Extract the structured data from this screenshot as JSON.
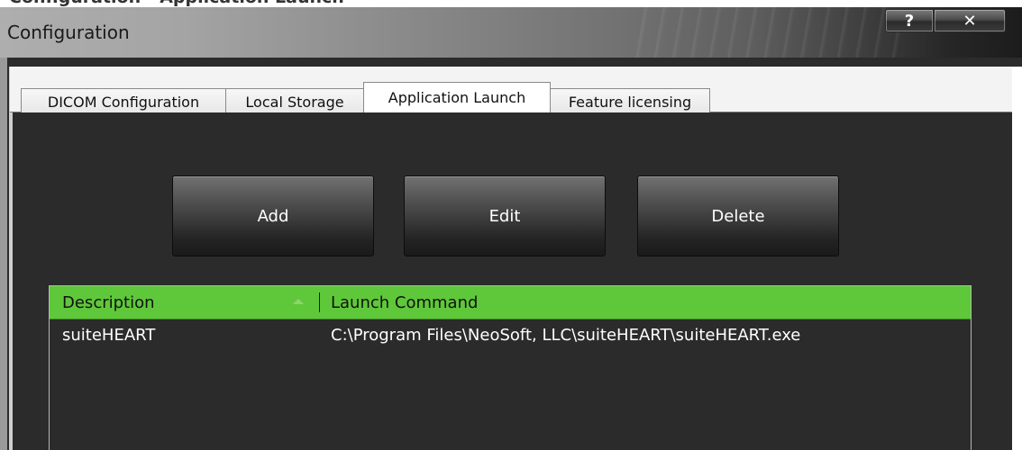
{
  "caption": {
    "heading": "Configuration - Application Launch"
  },
  "window": {
    "title": "Configuration",
    "help_label": "?",
    "close_label": "✕"
  },
  "tabs": [
    {
      "label": "DICOM Configuration",
      "active": false
    },
    {
      "label": "Local Storage",
      "active": false
    },
    {
      "label": "Application Launch",
      "active": true
    },
    {
      "label": "Feature licensing",
      "active": false
    }
  ],
  "actions": {
    "add_label": "Add",
    "edit_label": "Edit",
    "delete_label": "Delete"
  },
  "table": {
    "columns": [
      "Description",
      "Launch Command"
    ],
    "sorted_column": "Description",
    "rows": [
      {
        "description": "suiteHEART",
        "command": "C:\\Program Files\\NeoSoft, LLC\\suiteHEART\\suiteHEART.exe"
      }
    ]
  },
  "colors": {
    "header_green": "#5fc83a",
    "panel_dark": "#2b2b2b"
  }
}
